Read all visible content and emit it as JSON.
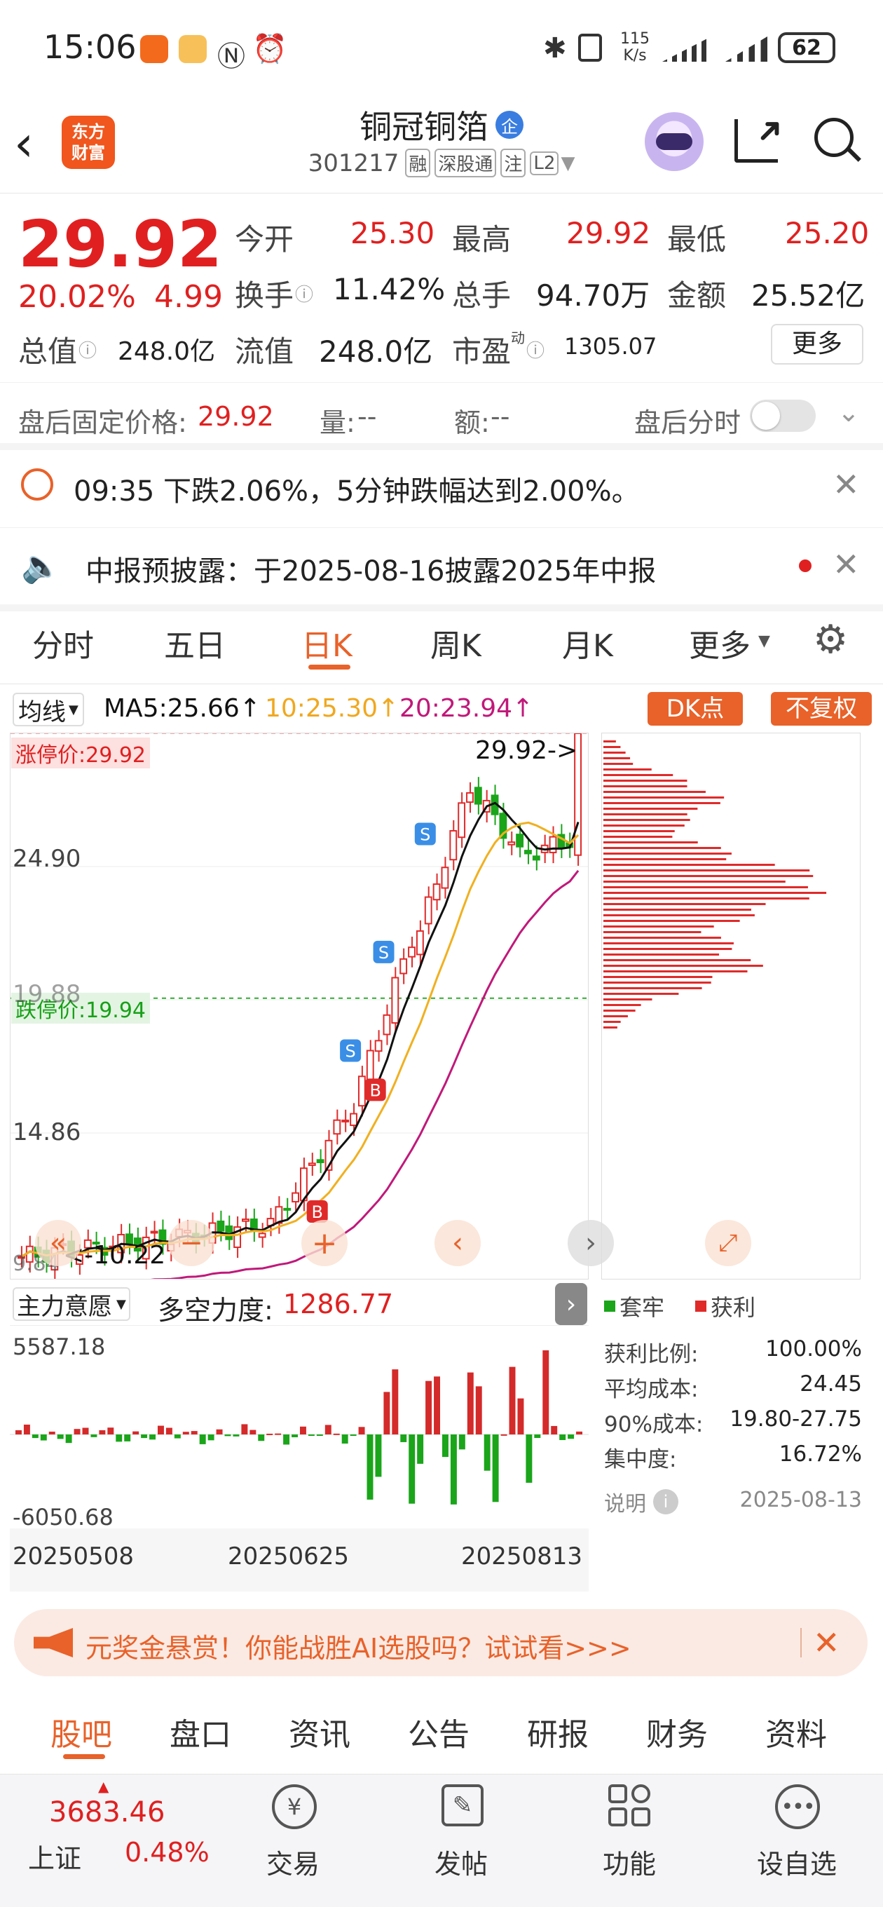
{
  "status_bar": {
    "time": "15:06",
    "net_speed_top": "115",
    "net_speed_bottom": "K/s",
    "battery": "62"
  },
  "header": {
    "back_icon": "chevron-left-icon",
    "logo_text_1": "东方",
    "logo_text_2": "财富",
    "title": "铜冠铜箔",
    "badge": "企",
    "code": "301217",
    "tags": [
      "融",
      "深股通",
      "注",
      "L2"
    ]
  },
  "quote": {
    "price": "29.92",
    "change_pct": "20.02%",
    "change": "4.99",
    "open_label": "今开",
    "open": "25.30",
    "high_label": "最高",
    "high": "29.92",
    "low_label": "最低",
    "low": "25.20",
    "turnover_label": "换手",
    "turnover": "11.42%",
    "volume_label": "总手",
    "volume": "94.70万",
    "amount_label": "金额",
    "amount": "25.52亿",
    "mktcap_label": "总值",
    "mktcap": "248.0亿",
    "float_label": "流值",
    "float": "248.0亿",
    "pe_label": "市盈",
    "pe_sup": "动",
    "pe": "1305.07",
    "more_button": "更多"
  },
  "after_hours": {
    "price_label": "盘后固定价格:",
    "price": "29.92",
    "vol_label": "量:",
    "vol": "--",
    "amt_label": "额:",
    "amt": "--",
    "toggle_label": "盘后分时"
  },
  "alerts": [
    {
      "text": "09:35 下跌2.06%，5分钟跌幅达到2.00%。"
    },
    {
      "text": "中报预披露：于2025-08-16披露2025年中报"
    }
  ],
  "chart_tabs": [
    "分时",
    "五日",
    "日K",
    "周K",
    "月K",
    "更多"
  ],
  "active_chart_tab": "日K",
  "indicator": {
    "ma_select": "均线",
    "ma5": "MA5:25.66↑",
    "ma10": "10:25.30↑",
    "ma20": "20:23.94↑",
    "dk_button": "DK点",
    "fq_button": "不复权"
  },
  "kline": {
    "limit_up_label": "涨停价:29.92",
    "limit_down_label": "跌停价:19.94",
    "max_label": "29.92->",
    "min_label": "<-10.22",
    "y_ticks": [
      "24.90",
      "19.88",
      "14.86",
      "9.84"
    ],
    "colors": {
      "up": "#e02a2a",
      "down": "#1aa51a",
      "ma5": "#111111",
      "ma10": "#f0b020",
      "ma20": "#c0197a"
    }
  },
  "chip": {
    "legend_locked": "套牢",
    "legend_profit": "获利",
    "rows": [
      {
        "label": "获利比例:",
        "value": "100.00%"
      },
      {
        "label": "平均成本:",
        "value": "24.45"
      },
      {
        "label": "90%成本:",
        "value": "19.80-27.75"
      },
      {
        "label": "集中度:",
        "value": "16.72%"
      }
    ],
    "note_label": "说明",
    "date": "2025-08-13"
  },
  "sub_indicator": {
    "select": "主力意愿",
    "name": "多空力度:",
    "value": "1286.77",
    "top": "5587.18",
    "bottom": "-6050.68",
    "dates": [
      "20250508",
      "20250625",
      "20250813"
    ]
  },
  "banner": {
    "text": "元奖金悬赏！你能战胜AI选股吗？试试看>>>"
  },
  "bottom_tabs": [
    "股吧",
    "盘口",
    "资讯",
    "公告",
    "研报",
    "财务",
    "资料"
  ],
  "active_bottom_tab": "股吧",
  "footer": {
    "index_value": "3683.46",
    "index_name": "上证",
    "index_change": "0.48%",
    "nav": [
      "交易",
      "发帖",
      "功能",
      "设自选"
    ]
  },
  "chart_data": {
    "type": "candlestick",
    "title": "",
    "ylim": [
      9.84,
      29.92
    ],
    "y_ticks": [
      24.9,
      19.88,
      14.86,
      9.84
    ],
    "x_ticks": [
      "20250508",
      "20250625",
      "20250813"
    ],
    "note": "daily candles, approx values read off chart",
    "series": [
      {
        "name": "MA5",
        "value_last": 25.66
      },
      {
        "name": "10",
        "value_last": 25.3
      },
      {
        "name": "20",
        "value_last": 23.94
      }
    ]
  }
}
